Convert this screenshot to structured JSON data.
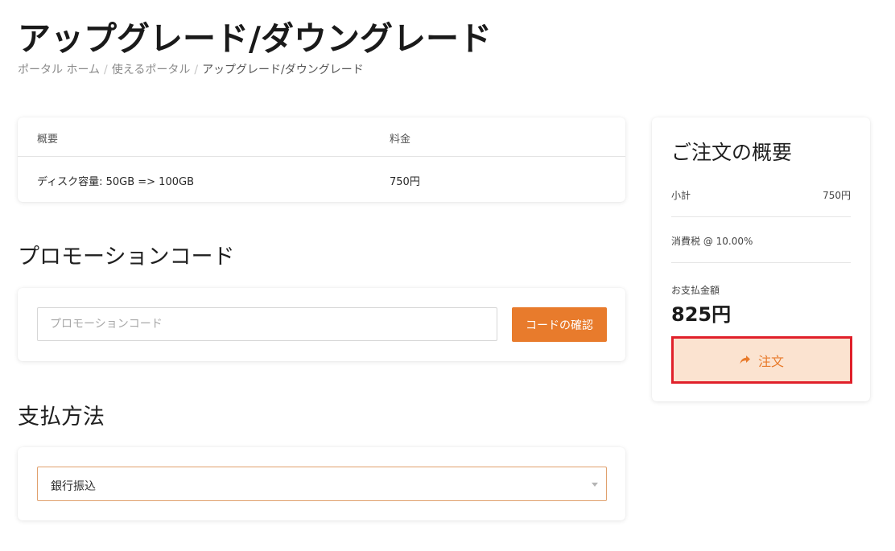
{
  "page": {
    "title": "アップグレード/ダウングレード"
  },
  "breadcrumb": {
    "items": [
      "ポータル ホーム",
      "使えるポータル",
      "アップグレード/ダウングレード"
    ],
    "separator": "/"
  },
  "items_table": {
    "headers": {
      "description": "概要",
      "price": "料金"
    },
    "rows": [
      {
        "description": "ディスク容量: 50GB => 100GB",
        "price": "750円"
      }
    ]
  },
  "promo": {
    "title": "プロモーションコード",
    "placeholder": "プロモーションコード",
    "value": "",
    "button_label": "コードの確認"
  },
  "payment": {
    "title": "支払方法",
    "selected": "銀行振込"
  },
  "summary": {
    "title": "ご注文の概要",
    "subtotal_label": "小計",
    "subtotal_value": "750円",
    "tax_label": "消費税 @ 10.00%",
    "tax_value": "",
    "total_label": "お支払金額",
    "total_value": "825円",
    "order_button_label": "注文",
    "order_button_icon": "share-icon"
  },
  "colors": {
    "accent": "#e87b2c",
    "highlight_border": "#e0202a",
    "order_button_bg": "#fbe3d0"
  }
}
